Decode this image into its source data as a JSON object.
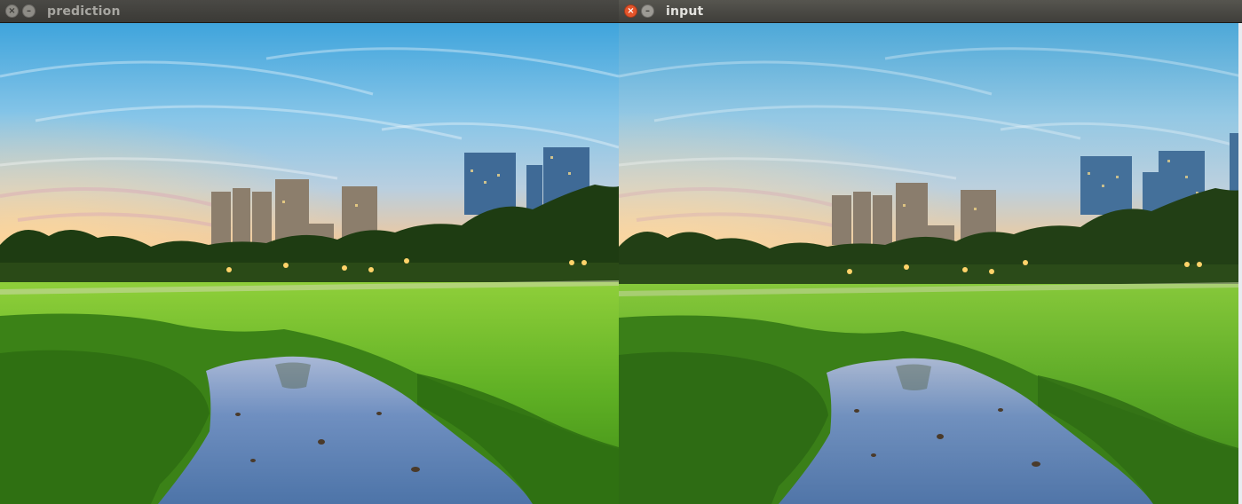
{
  "windows": [
    {
      "id": "prediction",
      "title": "prediction",
      "active": false
    },
    {
      "id": "input",
      "title": "input",
      "active": true
    }
  ],
  "controls": {
    "close_glyph": "×",
    "minimize_glyph": "–"
  },
  "images": {
    "prediction": {
      "content": "landscape-photo",
      "tone": "enhanced"
    },
    "input": {
      "content": "landscape-photo",
      "tone": "original"
    }
  },
  "colors": {
    "sky_top": "#3a9fd6",
    "sky_mid": "#8cc7e8",
    "sunset": "#f5c98a",
    "grass": "#5fae23",
    "grass_dark": "#2f6e12",
    "water": "#5f86b8",
    "trees": "#1f3d12",
    "close_button": "#e4542a"
  }
}
